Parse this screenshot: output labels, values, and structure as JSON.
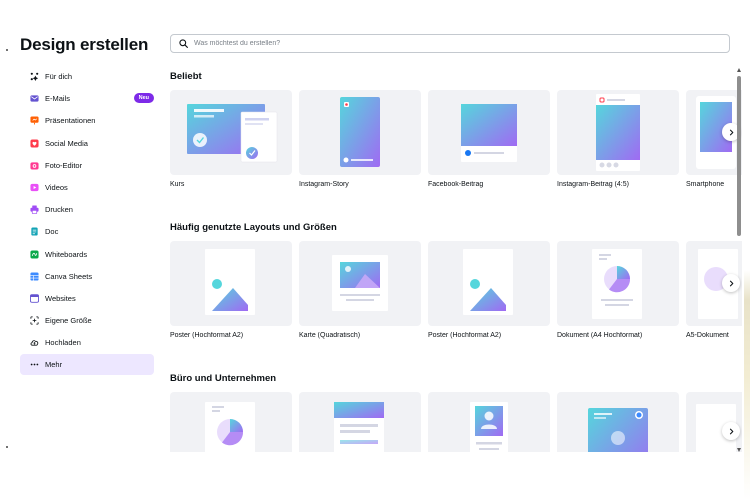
{
  "sidebar": {
    "title": "Design erstellen",
    "items": [
      {
        "label": "Für dich",
        "icon": "sparkle-icon",
        "color": "#0d1216"
      },
      {
        "label": "E-Mails",
        "icon": "mail-icon",
        "color": "#6453d0",
        "badge": "Neu"
      },
      {
        "label": "Präsentationen",
        "icon": "presentation-icon",
        "color": "#ff6105"
      },
      {
        "label": "Social Media",
        "icon": "heart-icon",
        "color": "#ff3b4b"
      },
      {
        "label": "Foto-Editor",
        "icon": "camera-icon",
        "color": "#ff3b93"
      },
      {
        "label": "Videos",
        "icon": "video-icon",
        "color": "#e950f7"
      },
      {
        "label": "Drucken",
        "icon": "printer-icon",
        "color": "#a04df5"
      },
      {
        "label": "Doc",
        "icon": "doc-icon",
        "color": "#13a3b5"
      },
      {
        "label": "Whiteboards",
        "icon": "whiteboard-icon",
        "color": "#0ba84a"
      },
      {
        "label": "Canva Sheets",
        "icon": "sheets-icon",
        "color": "#3d8bff"
      },
      {
        "label": "Websites",
        "icon": "website-icon",
        "color": "#6453d0"
      },
      {
        "label": "Eigene Größe",
        "icon": "custom-size-icon",
        "color": "#0d1216"
      },
      {
        "label": "Hochladen",
        "icon": "upload-cloud-icon",
        "color": "#0d1216"
      },
      {
        "label": "Mehr",
        "icon": "more-icon",
        "color": "#0d1216",
        "active": true
      }
    ]
  },
  "search": {
    "placeholder": "Was möchtest du erstellen?"
  },
  "sections": [
    {
      "title": "Beliebt",
      "cards": [
        "Kurs",
        "Instagram-Story",
        "Facebook-Beitrag",
        "Instagram-Beitrag (4:5)",
        "Smartphone"
      ]
    },
    {
      "title": "Häufig genutzte Layouts und Größen",
      "cards": [
        "Poster (Hochformat A2)",
        "Karte (Quadratisch)",
        "Poster (Hochformat A2)",
        "Dokument (A4 Hochformat)",
        "A5-Dokument"
      ]
    },
    {
      "title": "Büro und Unternehmen",
      "cards": [
        "",
        "",
        "",
        "",
        ""
      ]
    }
  ],
  "colors": {
    "accent": "#7d2ae8",
    "active_bg": "#ede7ff",
    "thumb_bg": "#f1f2f5",
    "gradient_start": "#55d6dc",
    "gradient_end": "#9b6bf2"
  }
}
